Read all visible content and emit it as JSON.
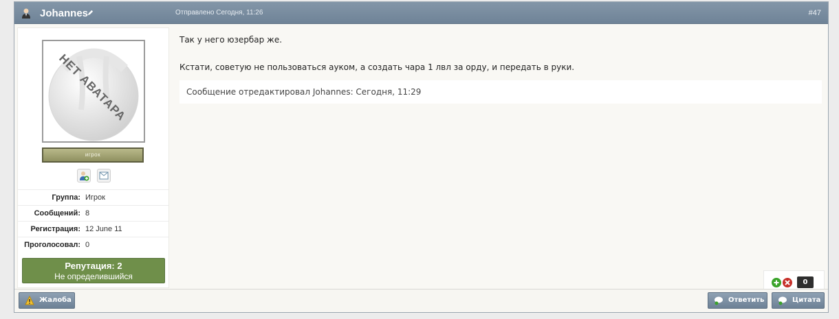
{
  "post": {
    "author": "Johannes",
    "sent_label": "Отправлено Сегодня, 11:26",
    "number": "#47"
  },
  "author_panel": {
    "avatar_text": "НЕТ АВАТАРА",
    "rank": "игрок",
    "info": [
      {
        "label": "Группа:",
        "value": "Игрок"
      },
      {
        "label": "Сообщений:",
        "value": "8"
      },
      {
        "label": "Регистрация:",
        "value": "12 June 11"
      },
      {
        "label": "Проголосовал:",
        "value": "0"
      }
    ],
    "reputation": {
      "title": "Репутация: 2",
      "subtitle": "Не определившийся",
      "color": "#6f8f4a"
    }
  },
  "body": {
    "line1": "Так у него юзербар же.",
    "line2": "Кстати, советую не пользоваться ауком, а создать чара 1 лвл за орду, и передать в руки.",
    "edit_note": "Сообщение отредактировал Johannes: Сегодня, 11:29"
  },
  "rating": {
    "count": "0"
  },
  "buttons": {
    "report": "Жалоба",
    "reply": "Ответить",
    "quote": "Цитата"
  },
  "icons": {
    "user": "user-icon",
    "edit": "pencil-icon",
    "add_friend": "add-friend-icon",
    "send_message": "message-icon",
    "warning": "warning-icon",
    "reply": "reply-icon",
    "quote": "quote-icon",
    "rate_up": "plus-icon",
    "rate_down": "minus-icon"
  }
}
